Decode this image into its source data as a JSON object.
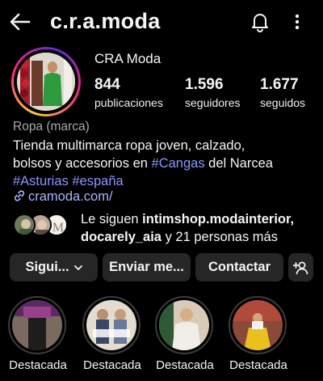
{
  "header": {
    "username": "c.r.a.moda",
    "icons": [
      "back-arrow-icon",
      "bell-icon",
      "more-vertical-icon"
    ]
  },
  "profile": {
    "display_name": "CRA Moda",
    "stats": [
      {
        "value": "844",
        "label": "publicaciones"
      },
      {
        "value": "1.596",
        "label": "seguidores"
      },
      {
        "value": "1.677",
        "label": "seguidos"
      }
    ],
    "category": "Ropa (marca)",
    "bio": {
      "line1": "Tienda multimarca ropa joven, calzado,",
      "line2_pre": "bolsos y accesorios en ",
      "line2_tag": "#Cangas",
      "line2_post": " del Narcea",
      "line3_tag1": "#Asturias",
      "line3_tag2": "#españa"
    },
    "link": "cramoda.com/"
  },
  "followed_by": {
    "prefix": "Le siguen ",
    "user1": "intimshop.modainterior,",
    "user2": "docarely_aia",
    "suffix": " y 21 personas más"
  },
  "buttons": {
    "following": "Sigui...",
    "message": "Enviar me...",
    "contact": "Contactar"
  },
  "highlights": [
    {
      "label": "Destacada"
    },
    {
      "label": "Destacada"
    },
    {
      "label": "Destacada"
    },
    {
      "label": "Destacada"
    }
  ],
  "colors": {
    "background": "#000000",
    "button_bg": "#262626",
    "hashtag": "#8b95ff",
    "link": "#a9b6ff",
    "muted_text": "#a8a8a8"
  }
}
